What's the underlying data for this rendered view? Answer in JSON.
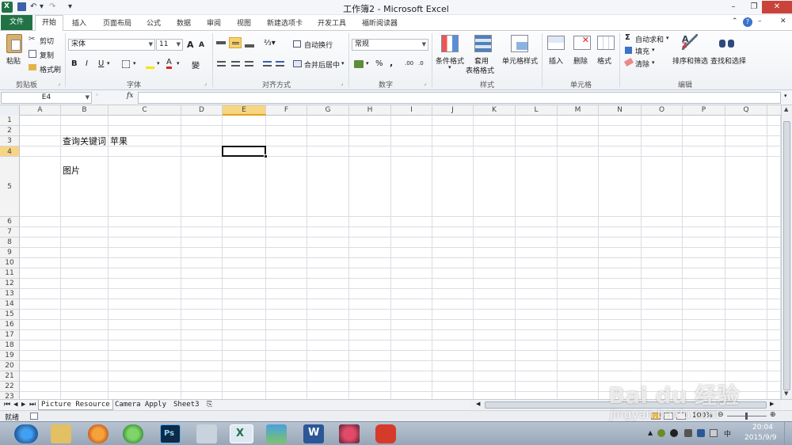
{
  "window": {
    "title": "工作簿2 - Microsoft Excel",
    "minimize": "–",
    "restore": "❐",
    "close": "✕"
  },
  "quick_access": {
    "undo": "↶",
    "redo": "↷",
    "more": "▾"
  },
  "tabs": {
    "file": "文件",
    "home": "开始",
    "items": [
      "插入",
      "页面布局",
      "公式",
      "数据",
      "审阅",
      "视图",
      "新建选项卡",
      "开发工具",
      "福昕阅读器"
    ]
  },
  "ribbon": {
    "clipboard": {
      "paste": "粘贴",
      "cut": "剪切",
      "copy": "复制",
      "format_painter": "格式刷",
      "label": "剪贴板"
    },
    "font": {
      "name": "宋体",
      "size": "11",
      "grow": "A",
      "shrink": "A",
      "bold": "B",
      "italic": "I",
      "underline": "U",
      "wen": "變",
      "label": "字体"
    },
    "alignment": {
      "wrap": "自动换行",
      "merge": "合并后居中",
      "label": "对齐方式"
    },
    "number": {
      "format": "常规",
      "percent": "%",
      "comma": ",",
      "label": "数字"
    },
    "styles": {
      "conditional": "条件格式",
      "table1": "套用",
      "table2": "表格格式",
      "cell_styles": "单元格样式",
      "label": "样式"
    },
    "cells": {
      "insert": "插入",
      "delete": "删除",
      "format": "格式",
      "label": "单元格"
    },
    "editing": {
      "autosum": "自动求和",
      "fill": "填充",
      "clear": "清除",
      "sort": "排序和筛选",
      "find": "查找和选择",
      "label": "编辑"
    }
  },
  "formula_bar": {
    "name_box": "E4",
    "fx": "fx",
    "value": ""
  },
  "columns": [
    "A",
    "B",
    "C",
    "D",
    "E",
    "F",
    "G",
    "H",
    "I",
    "J",
    "K",
    "L",
    "M",
    "N",
    "O",
    "P",
    "Q"
  ],
  "rows": [
    "1",
    "2",
    "3",
    "4",
    "5",
    "6",
    "7",
    "8",
    "9",
    "10",
    "11",
    "12",
    "13",
    "14",
    "15",
    "16",
    "17",
    "18",
    "19",
    "20",
    "21",
    "22",
    "23"
  ],
  "cells": {
    "B3": "查询关键词",
    "C3": "苹果",
    "B4": "图片"
  },
  "sheets": [
    "Picture Resource",
    "Camera Apply",
    "Sheet3"
  ],
  "status": {
    "ready": "就绪",
    "zoom": "100%"
  },
  "taskbar": {
    "time": "20:04",
    "date": "2015/9/9"
  },
  "watermark": {
    "logo": "Bai du 经验",
    "url": "jingyan.baidu.com"
  }
}
